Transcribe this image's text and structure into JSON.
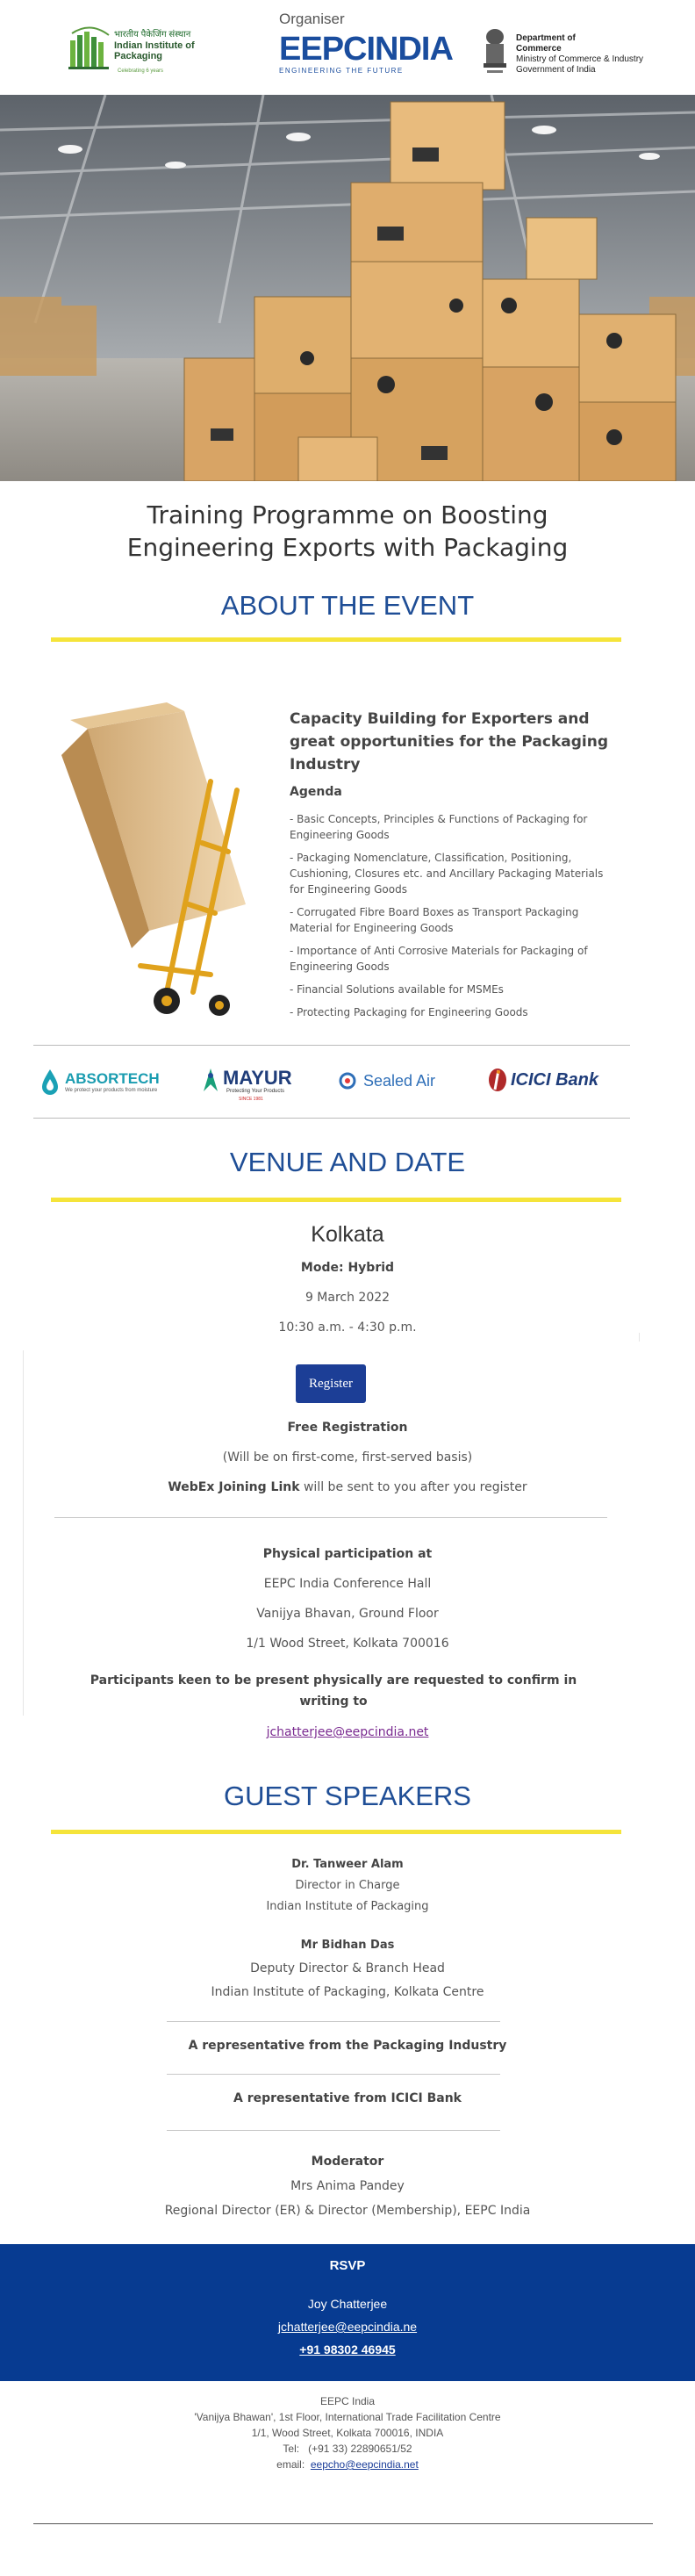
{
  "header": {
    "iip_logo": {
      "hindi": "भारतीय पैकेजिंग संस्थान",
      "name": "Indian Institute of Packaging",
      "tagline": "Celebrating 6 years"
    },
    "organiser_label": "Organiser",
    "eepc": {
      "name_a": "EEPC",
      "name_b": "INDIA",
      "tagline": "ENGINEERING THE FUTURE"
    },
    "doc_logo": {
      "line1": "Department of",
      "line2": "Commerce",
      "line3": "Ministry of Commerce & Industry",
      "line4": "Government of India"
    }
  },
  "title": {
    "line1": "Training Programme on Boosting",
    "line2": "Engineering Exports with Packaging"
  },
  "about": {
    "heading": "ABOUT THE EVENT",
    "subheading": "Capacity Building for Exporters and great opportunities for the Packaging Industry",
    "agenda_label": "Agenda",
    "agenda": [
      "- Basic Concepts, Principles & Functions of Packaging for Engineering Goods",
      "- Packaging Nomenclature, Classification, Positioning, Cushioning, Closures etc. and Ancillary Packaging Materials for Engineering Goods",
      "- Corrugated Fibre Board Boxes as Transport Packaging Material for Engineering Goods",
      "- Importance of Anti Corrosive Materials for Packaging of Engineering Goods",
      "- Financial Solutions available for MSMEs",
      "- Protecting Packaging for Engineering Goods"
    ]
  },
  "sponsors": {
    "absortech": {
      "name": "ABSORTECH",
      "tagline": "We protect your products from moisture"
    },
    "mayur": {
      "name": "MAYUR",
      "tagline": "Protecting Your Products",
      "since": "SINCE 1981"
    },
    "sealedair": {
      "name": "Sealed Air"
    },
    "icici": {
      "name": "ICICI Bank"
    }
  },
  "venue": {
    "heading": "VENUE AND DATE",
    "city": "Kolkata",
    "mode": "Mode: Hybrid",
    "date": "9 March 2022",
    "time": "10:30 a.m. - 4:30 p.m.",
    "register_label": "Register",
    "free_registration": "Free Registration",
    "first_come": "(Will be on first-come, first-served basis)",
    "webex_bold": "WebEx Joining Link",
    "webex_rest": " will be sent to you after you register",
    "physical_label": "Physical participation at",
    "address_1": "EEPC India Conference Hall",
    "address_2": "Vanijya Bhavan, Ground Floor",
    "address_3": "1/1 Wood Street, Kolkata 700016",
    "confirm_note": "Participants keen to be present physically are requested to confirm in writing to",
    "confirm_email": "jchatterjee@eepcindia.net"
  },
  "speakers": {
    "heading": "GUEST SPEAKERS",
    "s1": {
      "name": "Dr. Tanweer Alam",
      "role": "Director in Charge",
      "org": "Indian Institute of Packaging"
    },
    "s2": {
      "name": "Mr Bidhan Das",
      "role": "Deputy Director & Branch Head",
      "org": "Indian Institute of Packaging, Kolkata Centre"
    },
    "s3": "A representative from the Packaging Industry",
    "s4": "A representative from ICICI Bank",
    "moderator_label": "Moderator",
    "moderator_name": "Mrs Anima Pandey",
    "moderator_role": "Regional Director (ER) & Director (Membership), EEPC India"
  },
  "rsvp": {
    "title": "RSVP",
    "name": "Joy Chatterjee",
    "email": "jchatterjee@eepcindia.ne",
    "phone": "+91 98302 46945"
  },
  "footer": {
    "org": "EEPC India",
    "address_1": "'Vanijya Bhawan', 1st Floor, International Trade Facilitation Centre",
    "address_2": "1/1, Wood Street, Kolkata 700016, INDIA",
    "tel_label": "Tel:",
    "tel": "(+91 33) 22890651/52",
    "email_label": "email:",
    "email": "eepcho@eepcindia.net"
  },
  "colors": {
    "brand_blue": "#1f4e96",
    "rsvp_blue": "#073b91",
    "accent_yellow": "#f5e43a",
    "link_purple": "#7a2a90"
  }
}
